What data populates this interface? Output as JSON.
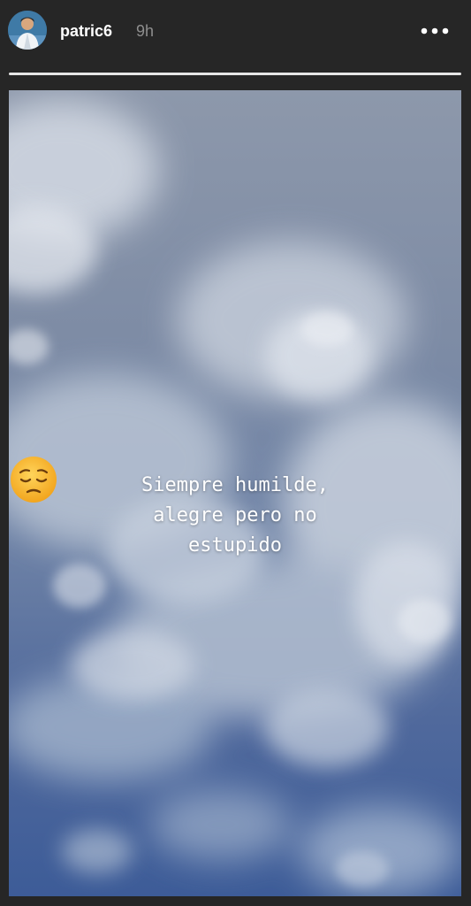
{
  "header": {
    "username": "patric6",
    "timestamp": "9h",
    "avatar_icon": "profile-avatar",
    "more_icon": "more-options-icon"
  },
  "progress": {
    "fraction": 1.0
  },
  "story": {
    "background": "cloudy-sky-photo",
    "sticker_emoji": "pensive-face-emoji",
    "caption": "Siempre humilde,\nalegre pero no\nestupido"
  },
  "colors": {
    "background": "#262626",
    "text_primary": "#ffffff",
    "text_secondary": "#8e8e8e"
  }
}
